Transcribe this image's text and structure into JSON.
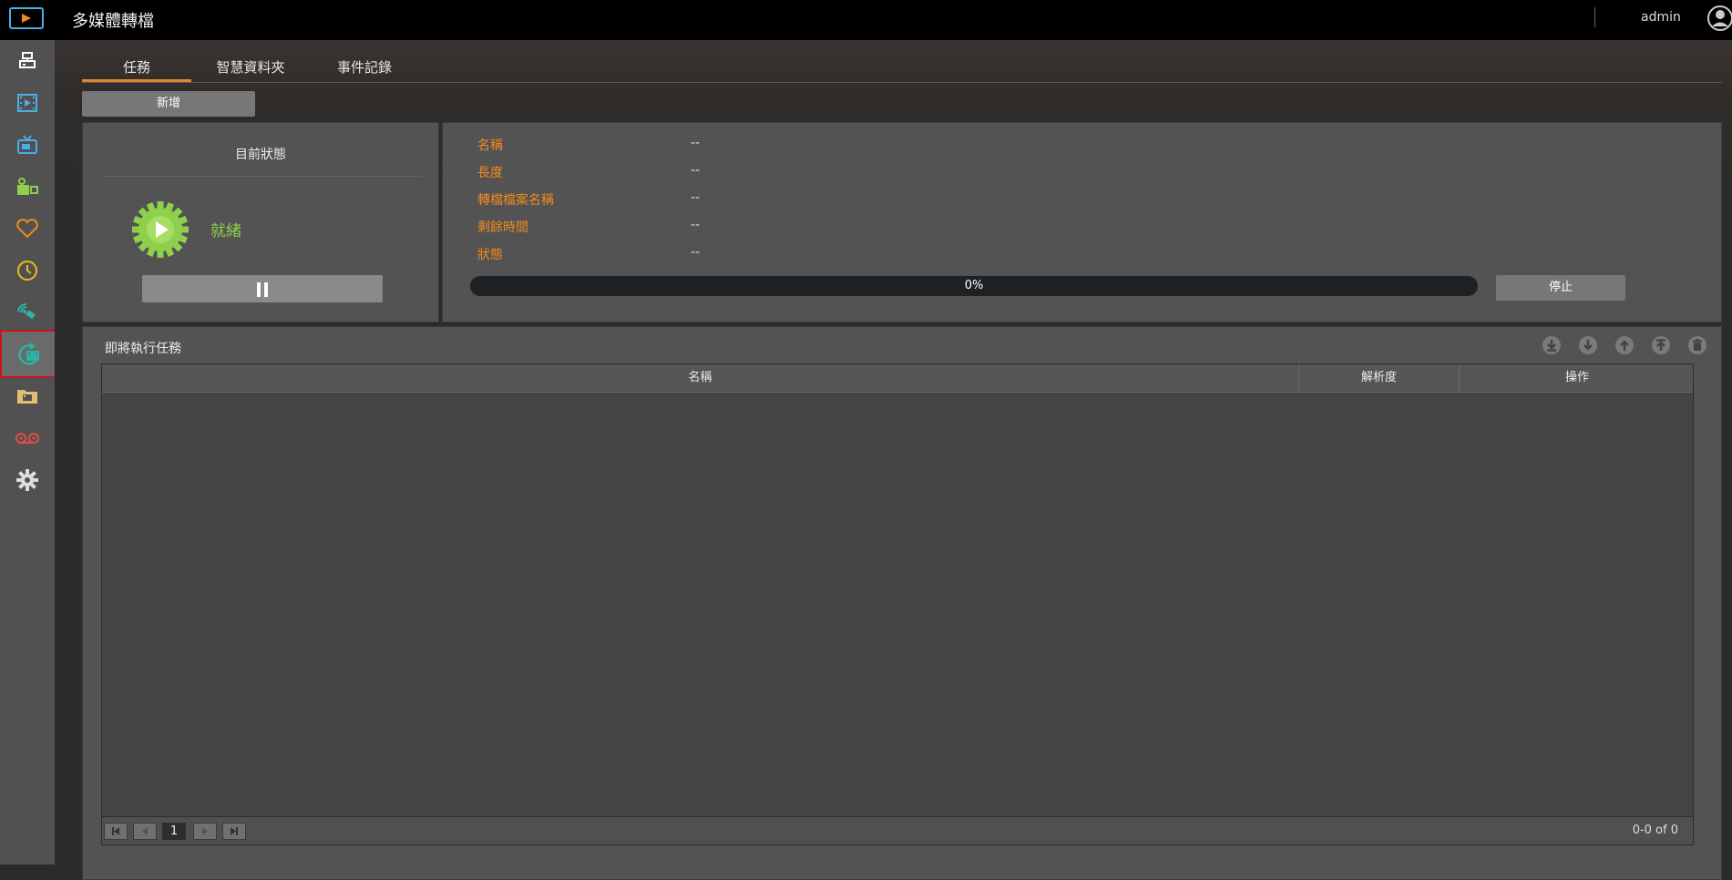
{
  "header": {
    "app_title": "多媒體轉檔",
    "user_name": "admin",
    "icons": [
      "app-logo-icon",
      "user-avatar-icon"
    ]
  },
  "sidebar": {
    "items": [
      {
        "icon": "server-icon",
        "color": "#ffffff"
      },
      {
        "icon": "film-icon",
        "color": "#4ab0e4"
      },
      {
        "icon": "tv-icon",
        "color": "#4ab0e4"
      },
      {
        "icon": "camcorder-icon",
        "color": "#8ed04b"
      },
      {
        "icon": "heart-icon",
        "color": "#f08a1c"
      },
      {
        "icon": "clock-icon",
        "color": "#f0b81c"
      },
      {
        "icon": "satellite-icon",
        "color": "#2bb3a3"
      },
      {
        "icon": "transcode-icon",
        "color": "#2bb3a3",
        "active": true
      },
      {
        "icon": "folder-icon",
        "color": "#e0c070"
      },
      {
        "icon": "tape-icon",
        "color": "#e84a4a"
      },
      {
        "icon": "gear-icon",
        "color": "#dddddd"
      }
    ]
  },
  "tabs": [
    "任務",
    "智慧資料夾",
    "事件記錄"
  ],
  "active_tab": 0,
  "toolbar": {
    "add_label": "新增"
  },
  "status": {
    "title": "目前狀態",
    "state": "就緒",
    "pause_icon": "pause-icon"
  },
  "info": {
    "rows": [
      {
        "label": "名稱",
        "value": "--"
      },
      {
        "label": "長度",
        "value": "--"
      },
      {
        "label": "轉檔檔案名稱",
        "value": "--"
      },
      {
        "label": "剩餘時間",
        "value": "--"
      },
      {
        "label": "狀態",
        "value": "--"
      }
    ],
    "progress_percent": 0,
    "progress_text": "0%",
    "stop_label": "停止"
  },
  "queue": {
    "title": "即將執行任務",
    "actions": [
      "move-bottom-icon",
      "move-down-icon",
      "move-up-icon",
      "move-top-icon",
      "delete-icon"
    ],
    "columns": [
      "名稱",
      "解析度",
      "操作"
    ],
    "rows": [],
    "pagination": {
      "page": "1",
      "info": "0-0 of 0"
    }
  },
  "colors": {
    "accent": "#e8822a",
    "label": "#f08a1c",
    "ready": "#8ed04b"
  }
}
